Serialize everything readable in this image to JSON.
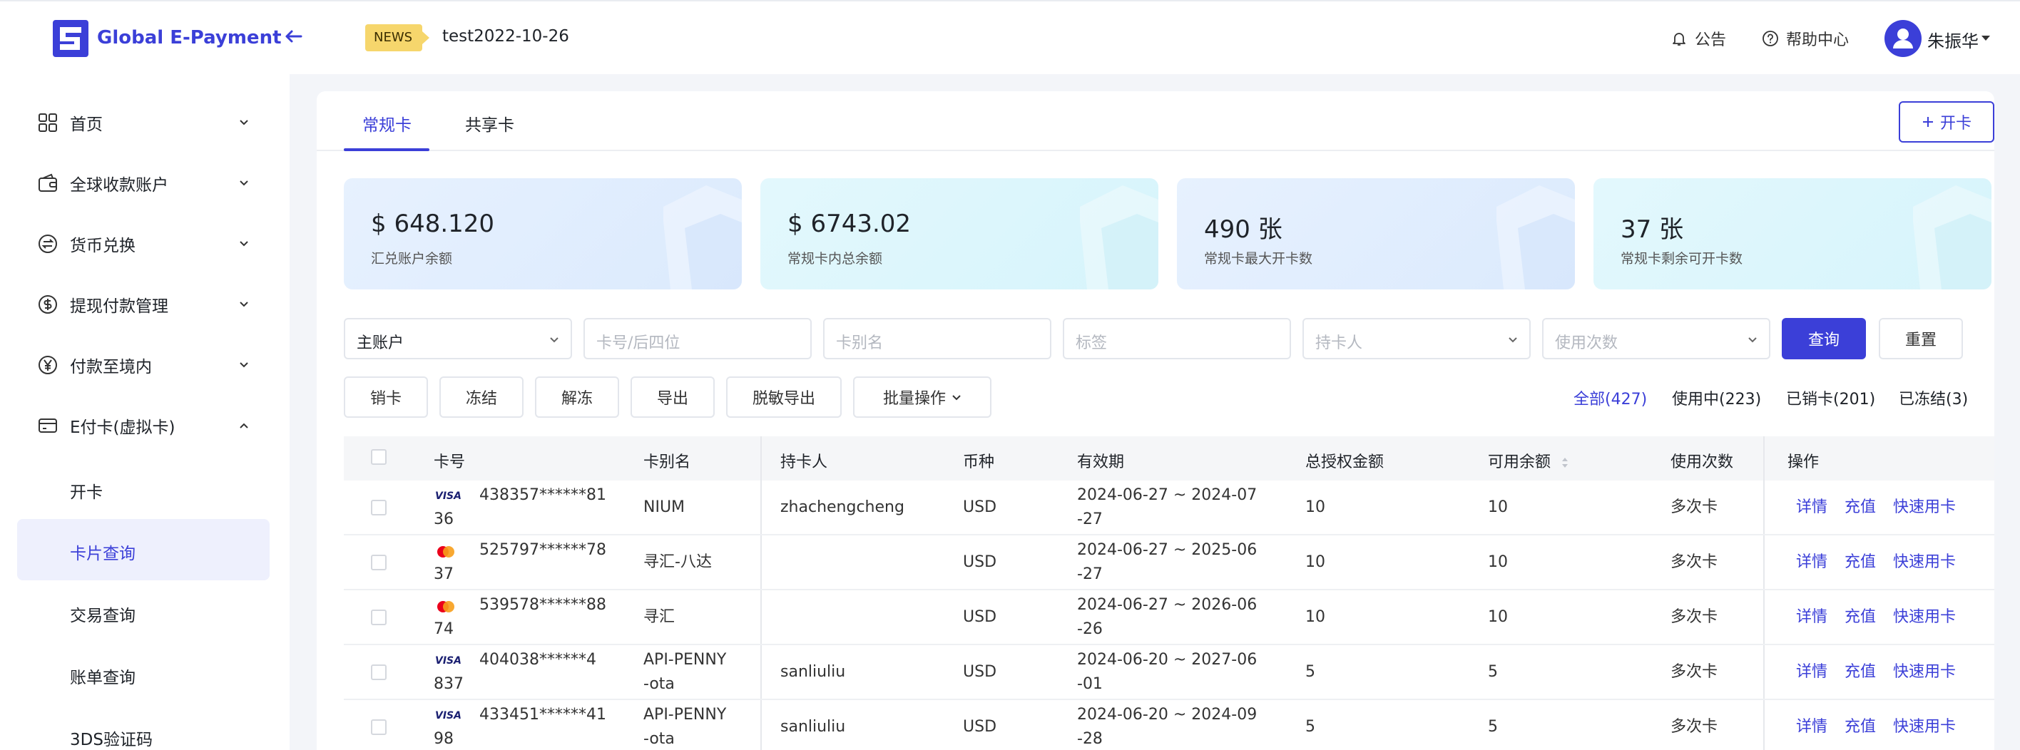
{
  "header": {
    "logo_text": "Global E-Payment",
    "news_badge": "NEWS",
    "news_text": "test2022-10-26",
    "announcement": "公告",
    "help_center": "帮助中心",
    "user_name": "朱振华"
  },
  "sidebar": {
    "items": [
      {
        "label": "首页",
        "icon": "grid-icon"
      },
      {
        "label": "全球收款账户",
        "icon": "wallet-icon"
      },
      {
        "label": "货币兑换",
        "icon": "exchange-icon"
      },
      {
        "label": "提现付款管理",
        "icon": "dollar-icon"
      },
      {
        "label": "付款至境内",
        "icon": "yen-icon"
      },
      {
        "label": "E付卡(虚拟卡)",
        "icon": "card-icon"
      }
    ],
    "sub_items": [
      {
        "label": "开卡"
      },
      {
        "label": "卡片查询"
      },
      {
        "label": "交易查询"
      },
      {
        "label": "账单查询"
      },
      {
        "label": "3DS验证码"
      }
    ]
  },
  "tabs": [
    {
      "label": "常规卡"
    },
    {
      "label": "共享卡"
    }
  ],
  "open_card_label": "开卡",
  "stats": [
    {
      "value": "$ 648.120",
      "label": "汇兑账户余额"
    },
    {
      "value": "$ 6743.02",
      "label": "常规卡内总余额"
    },
    {
      "value": "490 张",
      "label": "常规卡最大开卡数"
    },
    {
      "value": "37 张",
      "label": "常规卡剩余可开卡数"
    }
  ],
  "filters": {
    "account_value": "主账户",
    "card_no_placeholder": "卡号/后四位",
    "card_alias_placeholder": "卡别名",
    "tag_placeholder": "标签",
    "holder_placeholder": "持卡人",
    "usage_placeholder": "使用次数",
    "query_label": "查询",
    "reset_label": "重置"
  },
  "actions": {
    "cancel_card": "销卡",
    "freeze": "冻结",
    "unfreeze": "解冻",
    "export": "导出",
    "masked_export": "脱敏导出",
    "batch_ops": "批量操作"
  },
  "status_filters": [
    {
      "label": "全部(427)"
    },
    {
      "label": "使用中(223)"
    },
    {
      "label": "已销卡(201)"
    },
    {
      "label": "已冻结(3)"
    }
  ],
  "table": {
    "headers": [
      "卡号",
      "卡别名",
      "持卡人",
      "币种",
      "有效期",
      "总授权金额",
      "可用余额",
      "使用次数",
      "操作"
    ],
    "rows": [
      {
        "brand": "VISA",
        "card_no_1": "438357******81",
        "card_no_2": "36",
        "alias_1": "NIUM",
        "alias_2": "",
        "holder": "zhachengcheng",
        "currency": "USD",
        "validity_1": "2024-06-27 ~ 2024-07",
        "validity_2": "-27",
        "total": "10",
        "available": "10",
        "usage": "多次卡"
      },
      {
        "brand": "MC",
        "card_no_1": "525797******78",
        "card_no_2": "37",
        "alias_1": "寻汇-八达",
        "alias_2": "",
        "holder": "",
        "currency": "USD",
        "validity_1": "2024-06-27 ~ 2025-06",
        "validity_2": "-27",
        "total": "10",
        "available": "10",
        "usage": "多次卡"
      },
      {
        "brand": "MC",
        "card_no_1": "539578******88",
        "card_no_2": "74",
        "alias_1": "寻汇",
        "alias_2": "",
        "holder": "",
        "currency": "USD",
        "validity_1": "2024-06-27 ~ 2026-06",
        "validity_2": "-26",
        "total": "10",
        "available": "10",
        "usage": "多次卡"
      },
      {
        "brand": "VISA",
        "card_no_1": "404038******4",
        "card_no_2": "837",
        "alias_1": "API-PENNY",
        "alias_2": "-ota",
        "holder": "sanliuliu",
        "currency": "USD",
        "validity_1": "2024-06-20 ~ 2027-06",
        "validity_2": "-01",
        "total": "5",
        "available": "5",
        "usage": "多次卡"
      },
      {
        "brand": "VISA",
        "card_no_1": "433451******41",
        "card_no_2": "98",
        "alias_1": "API-PENNY",
        "alias_2": "-ota",
        "holder": "sanliuliu",
        "currency": "USD",
        "validity_1": "2024-06-20 ~ 2024-09",
        "validity_2": "-28",
        "total": "5",
        "available": "5",
        "usage": "多次卡"
      }
    ],
    "row_actions": [
      "详情",
      "充值",
      "快速用卡"
    ]
  },
  "colors": {
    "accent": "#3b3fd8",
    "news_badge": "#f6d66c",
    "stat_blue": "#e7f1fe",
    "stat_cyan": "#e3f8fd"
  }
}
